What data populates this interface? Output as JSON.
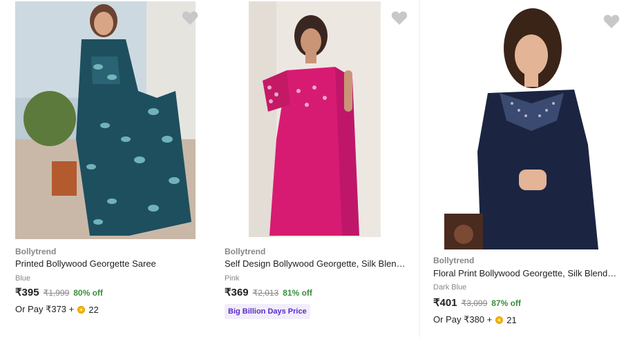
{
  "products": [
    {
      "brand": "Bollytrend",
      "title": "Printed Bollywood Georgette Saree",
      "color": "Blue",
      "price": "₹395",
      "mrp": "₹1,999",
      "discount": "80% off",
      "pay_prefix": "Or Pay ₹373 +",
      "coins": "22",
      "image": {
        "description_icon": "saree-photo",
        "saree_color": "#1e4f5f",
        "bg_color": "#c9d6dd"
      }
    },
    {
      "brand": "Bollytrend",
      "title": "Self Design Bollywood Georgette, Silk Blend ...",
      "color": "Pink",
      "price": "₹369",
      "mrp": "₹2,013",
      "discount": "81% off",
      "badge": "Big Billion Days Price",
      "image": {
        "description_icon": "saree-photo",
        "saree_color": "#d81b72",
        "bg_color": "#efe9e4"
      }
    },
    {
      "brand": "Bollytrend",
      "title": "Floral Print Bollywood Georgette, Silk Blend S...",
      "color": "Dark Blue",
      "price": "₹401",
      "mrp": "₹3,099",
      "discount": "87% off",
      "pay_prefix": "Or Pay ₹380 +",
      "coins": "21",
      "image": {
        "description_icon": "saree-photo",
        "saree_color": "#1b2541",
        "bg_color": "#ffffff"
      }
    }
  ],
  "colors": {
    "discount_green": "#388e3c",
    "muted_gray": "#878787",
    "badge_purple": "#5a2cc4",
    "heart_gray": "#c8c8c8"
  }
}
